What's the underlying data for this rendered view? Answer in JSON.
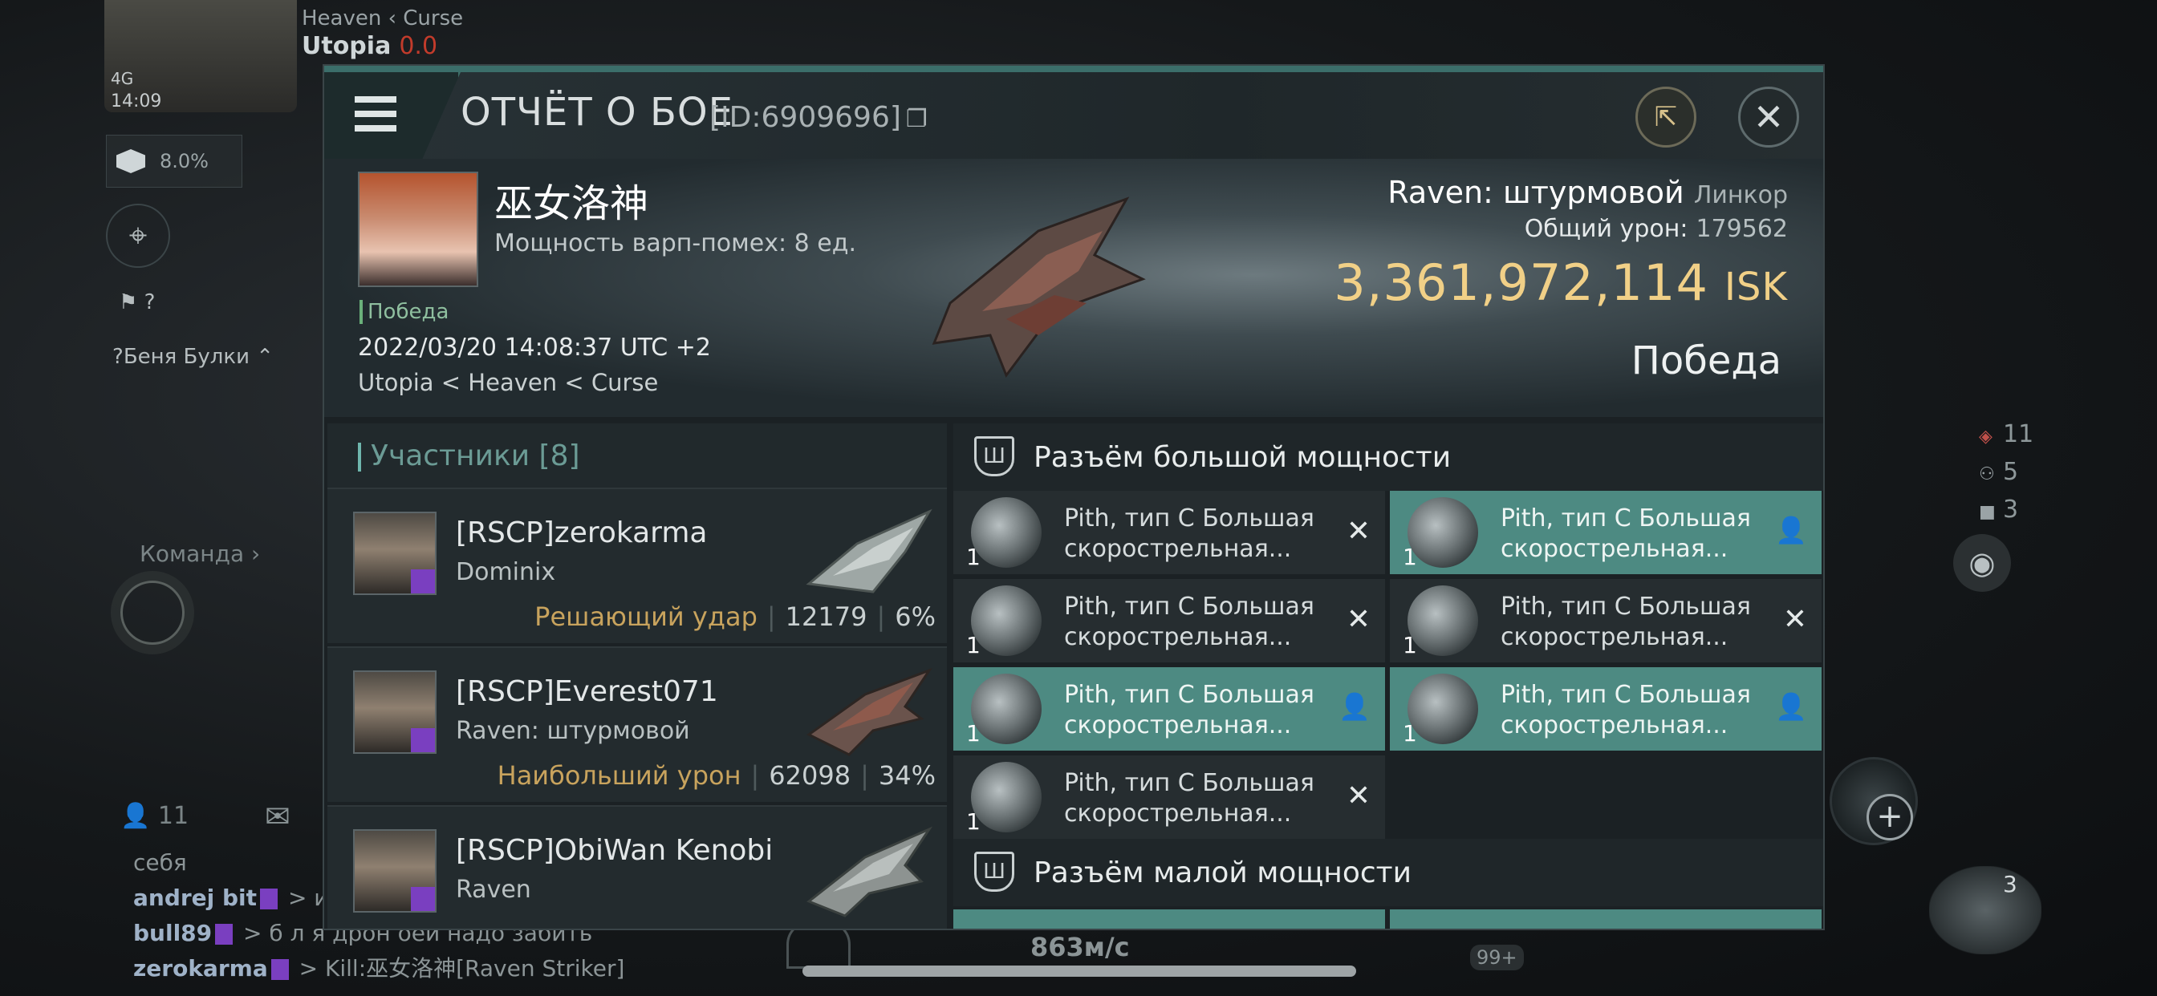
{
  "hud": {
    "path": "Heaven  ‹ Curse",
    "system": "Utopia",
    "security": "0.0",
    "signal": "4G",
    "time": "14:09",
    "cargo_pct": "8.0%",
    "team_label": "Команда  ›",
    "people_count": "11",
    "chat_self": "себя",
    "chat": [
      {
        "nick": "andrej bit",
        "text": " > и л"
      },
      {
        "nick": "bull89",
        "text": " > б л я дрон оей надо забить"
      },
      {
        "nick": "zerokarma",
        "text": " > Kill:巫女洛神[Raven Striker]"
      }
    ],
    "buddy_name": "Беня Булки",
    "right_stats": [
      "11",
      "5",
      "3"
    ],
    "speed": "863м/с",
    "drone_count": "3",
    "ship_badge": "99+"
  },
  "modal": {
    "title": "ОТЧЁТ О БОЕ",
    "id": "[ID:6909696]",
    "victim": {
      "name": "巫女洛神",
      "warp": "Мощность варп-помех: 8 ед.",
      "tag": "Победа",
      "date": "2022/03/20 14:08:37 UTC +2",
      "location": "Utopia < Heaven < Curse"
    },
    "ship": {
      "name": "Raven: штурмовой",
      "class": "Линкор",
      "damage_label": "Общий урон:",
      "damage_value": "179562",
      "isk_value": "3,361,972,114",
      "isk_unit": "ISK",
      "result": "Победа"
    },
    "participants_label": "Участники [8]",
    "participants": [
      {
        "name": "[RSCP]zerokarma",
        "ship": "Dominix",
        "role": "Решающий удар",
        "damage": "12179",
        "pct": "6%"
      },
      {
        "name": "[RSCP]Everest071",
        "ship": "Raven: штурмовой",
        "role": "Наибольший урон",
        "damage": "62098",
        "pct": "34%"
      },
      {
        "name": "[RSCP]ObiWan Kenobi",
        "ship": "Raven",
        "role": "",
        "damage": "",
        "pct": ""
      }
    ],
    "high_slots_label": "Разъём большой мощности",
    "low_slots_label": "Разъём малой мощности",
    "module_name": "Pith, тип C Большая скорострельная...",
    "modules": [
      {
        "qty": "1",
        "name": "Pith, тип C Большая скорострельная...",
        "state": "destroyed"
      },
      {
        "qty": "1",
        "name": "Pith, тип C Большая скорострельная...",
        "state": "dropped"
      },
      {
        "qty": "1",
        "name": "Pith, тип C Большая скорострельная...",
        "state": "destroyed"
      },
      {
        "qty": "1",
        "name": "Pith, тип C Большая скорострельная...",
        "state": "destroyed"
      },
      {
        "qty": "1",
        "name": "Pith, тип C Большая скорострельная...",
        "state": "dropped"
      },
      {
        "qty": "1",
        "name": "Pith, тип C Большая скорострельная...",
        "state": "dropped"
      },
      {
        "qty": "1",
        "name": "Pith, тип C Большая скорострельная...",
        "state": "destroyed"
      }
    ],
    "icons": {
      "destroyed": "✕",
      "dropped": "pilot-icon"
    }
  }
}
